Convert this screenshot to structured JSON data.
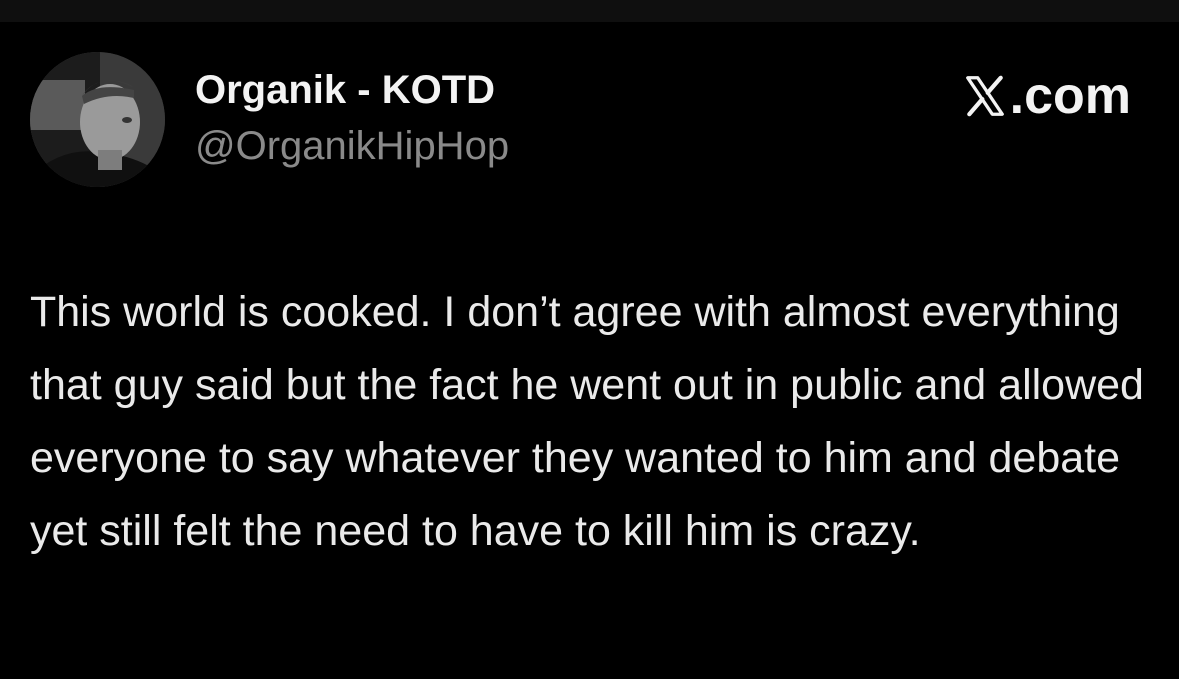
{
  "tweet": {
    "author_name": "Organik - KOTD",
    "author_handle": "@OrganikHipHop",
    "brand_label": ".com",
    "text": "This world is cooked. I don’t agree with almost everything that guy said but the fact he went out in public and allowed everyone to say whatever they wanted to him and debate yet still felt the need to have to kill him is crazy."
  },
  "icons": {
    "brand": "x-logo-icon",
    "avatar": "profile-photo"
  },
  "colors": {
    "background": "#000000",
    "name": "#f3f3f3",
    "handle": "#8a8a8a",
    "text": "#eaeaea"
  }
}
